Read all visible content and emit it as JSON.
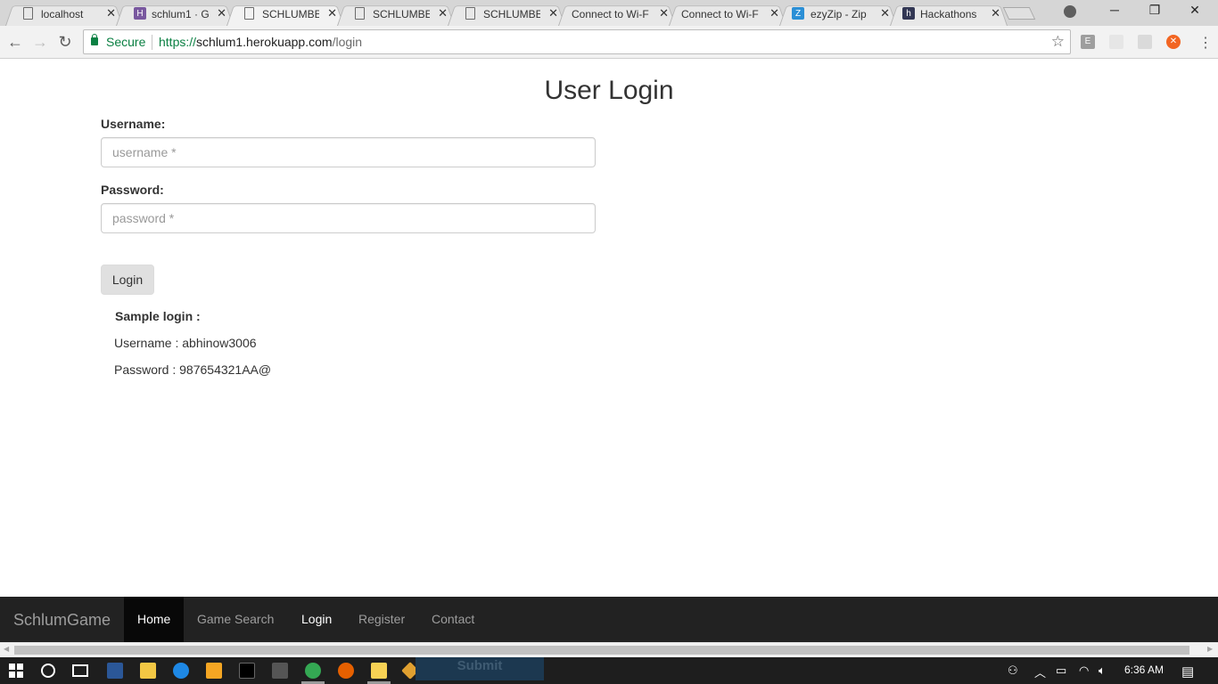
{
  "browser": {
    "tabs": [
      {
        "title": "localhost",
        "favicon": "page-icon"
      },
      {
        "title": "schlum1 · G",
        "favicon": "heroku-icon"
      },
      {
        "title": "SCHLUMBE",
        "favicon": "page-icon"
      },
      {
        "title": "SCHLUMBE",
        "favicon": "page-icon"
      },
      {
        "title": "SCHLUMBE",
        "favicon": "page-icon"
      },
      {
        "title": "Connect to Wi-F",
        "favicon": "none"
      },
      {
        "title": "Connect to Wi-F",
        "favicon": "none"
      },
      {
        "title": "ezyZip - Zip",
        "favicon": "ezyzip-icon"
      },
      {
        "title": "Hackathons",
        "favicon": "hackerearth-icon"
      }
    ],
    "active_tab_index": 2,
    "secure_label": "Secure",
    "url_scheme": "https://",
    "url_host": "schlum1.herokuapp.com",
    "url_path": "/login"
  },
  "page": {
    "title": "User Login",
    "username_label": "Username:",
    "username_placeholder": "username *",
    "password_label": "Password:",
    "password_placeholder": "password *",
    "login_button": "Login",
    "sample_title": "Sample login :",
    "sample_username": "Username : abhinow3006",
    "sample_password": "Password : 987654321AA@"
  },
  "navbar": {
    "brand": "SchlumGame",
    "items": [
      {
        "label": "Home"
      },
      {
        "label": "Game Search"
      },
      {
        "label": "Login"
      },
      {
        "label": "Register"
      },
      {
        "label": "Contact"
      }
    ]
  },
  "taskbar": {
    "overlay_button": "Submit",
    "clock": "6:36 AM"
  },
  "colors": {
    "secure_green": "#0b8043",
    "navbar_bg": "#222222",
    "navbar_active_bg": "#080808",
    "taskbar_bg": "#1e1e1e"
  }
}
